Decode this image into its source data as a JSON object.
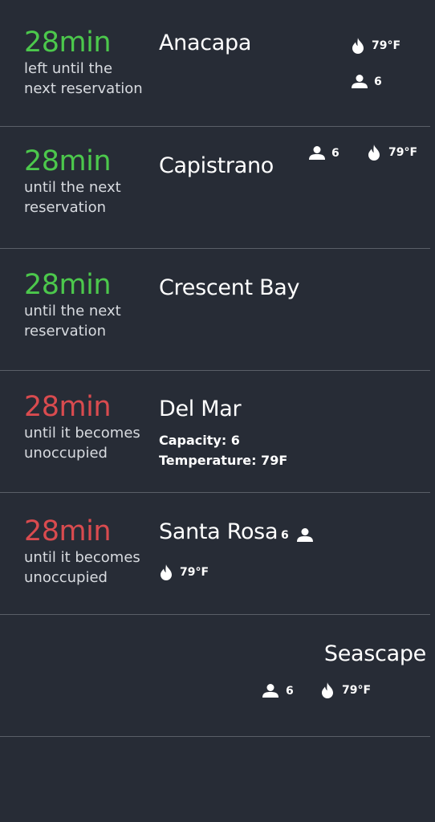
{
  "rooms": [
    {
      "time": "28min",
      "label_line1": "left until the",
      "label_line2": "next reservation",
      "name": "Anacapa",
      "temperature": "79°F",
      "capacity": "6"
    },
    {
      "time": "28min",
      "label_line1": "until the next",
      "label_line2": "reservation",
      "name": "Capistrano",
      "temperature": "79°F",
      "capacity": "6"
    },
    {
      "time": "28min",
      "label_line1": "until the next",
      "label_line2": "reservation",
      "name": "Crescent Bay"
    },
    {
      "time": "28min",
      "label_line1": "until it becomes",
      "label_line2": "unoccupied",
      "name": "Del Mar",
      "capacity_text": "Capacity: 6",
      "temperature_text": "Temperature: 79F"
    },
    {
      "time": "28min",
      "label_line1": "until it becomes",
      "label_line2": "unoccupied",
      "name": "Santa Rosa",
      "capacity": "6",
      "temperature": "79°F"
    },
    {
      "name": "Seascape",
      "capacity": "6",
      "temperature": "79°F"
    }
  ],
  "colors": {
    "available": "#4cc84c",
    "occupied": "#d94b4f",
    "background": "#272c36"
  },
  "icons": {
    "temperature": "flame-icon",
    "capacity": "person-icon"
  }
}
